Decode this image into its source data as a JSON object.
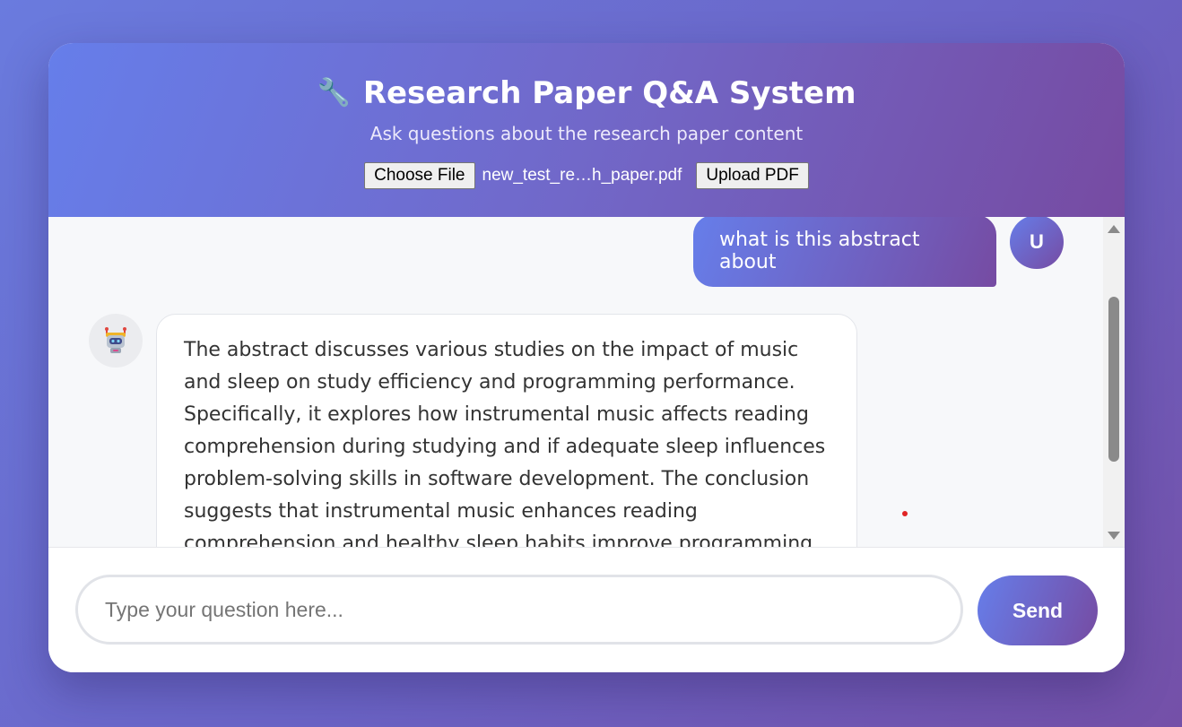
{
  "header": {
    "icon": "wrench-icon",
    "title": "Research Paper Q&A System",
    "subtitle": "Ask questions about the research paper content"
  },
  "upload": {
    "choose_file_label": "Choose File",
    "file_name": "new_test_re…h_paper.pdf",
    "upload_button_label": "Upload PDF"
  },
  "chat": {
    "messages": [
      {
        "role": "user",
        "avatar": "U",
        "text": "what is this abstract about"
      },
      {
        "role": "bot",
        "avatar_icon": "robot-icon",
        "text": "The abstract discusses various studies on the impact of music and sleep on study efficiency and programming performance. Specifically, it explores how instrumental music affects reading comprehension during studying and if adequate sleep influences problem-solving skills in software development. The conclusion suggests that instrumental music enhances reading comprehension and healthy sleep habits improve programming efficiency and"
      }
    ]
  },
  "input": {
    "placeholder": "Type your question here...",
    "value": "",
    "send_label": "Send"
  },
  "colors": {
    "accent_start": "#667eea",
    "accent_end": "#764ba2",
    "page_background": "#6b64c6",
    "chat_background": "#f7f8fa"
  }
}
